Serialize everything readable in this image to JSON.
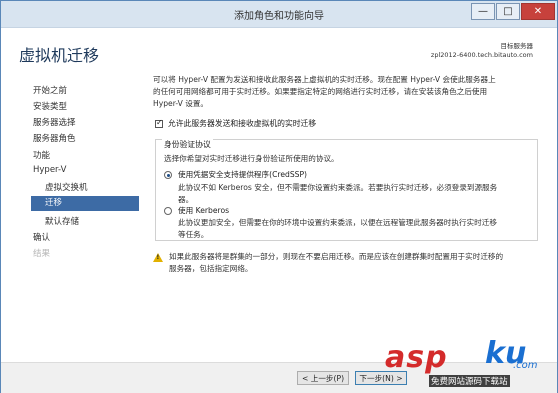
{
  "window": {
    "title": "添加角色和功能向导",
    "controls": {
      "minimize": "—",
      "maximize": "□",
      "close": "✕"
    }
  },
  "header": {
    "page_title": "虚拟机迁移",
    "destination_label": "目标服务器",
    "destination_server": "zpl2012-6400.tech.bitauto.com"
  },
  "nav": {
    "items": [
      {
        "label": "开始之前",
        "state": "normal"
      },
      {
        "label": "安装类型",
        "state": "normal"
      },
      {
        "label": "服务器选择",
        "state": "normal"
      },
      {
        "label": "服务器角色",
        "state": "normal"
      },
      {
        "label": "功能",
        "state": "normal"
      },
      {
        "label": "Hyper-V",
        "state": "normal"
      },
      {
        "label": "虚拟交换机",
        "state": "normal"
      },
      {
        "label": "迁移",
        "state": "active"
      },
      {
        "label": "默认存储",
        "state": "normal"
      },
      {
        "label": "确认",
        "state": "normal"
      },
      {
        "label": "结果",
        "state": "disabled"
      }
    ]
  },
  "content": {
    "intro_lines": [
      "可以将 Hyper-V 配置为发送和接收此服务器上虚拟机的实时迁移。现在配置 Hyper-V 会使此服务器上",
      "的任何可用网络都可用于实时迁移。如果要指定特定的网络进行实时迁移，请在安装该角色之后使用",
      "Hyper-V 设置。"
    ],
    "allow_checkbox": {
      "label": "允许此服务器发送和接收虚拟机的实时迁移",
      "checked": true
    },
    "auth_group": {
      "title": "身份验证协议",
      "description": "选择你希望对实时迁移进行身份验证所使用的协议。",
      "options": [
        {
          "label": "使用凭据安全支持提供程序(CredSSP)",
          "selected": true,
          "desc_lines": [
            "此协议不如 Kerberos 安全，但不需要你设置约束委派。若要执行实时迁移，必须登录到源服务",
            "器。"
          ]
        },
        {
          "label": "使用 Kerberos",
          "selected": false,
          "desc_lines": [
            "此协议更加安全，但需要在你的环境中设置约束委派，以便在远程管理此服务器时执行实时迁移",
            "等任务。"
          ]
        }
      ]
    },
    "warning_lines": [
      "如果此服务器将是群集的一部分，则现在不要启用迁移。而是应该在创建群集时配置用于实时迁移的",
      "服务器，包括指定网络。"
    ]
  },
  "footer": {
    "prev_label": "< 上一步(P)",
    "next_label": "下一步(N) >"
  },
  "watermark": {
    "brand_part1": "asp",
    "brand_part2": "ku",
    "suffix": ".com",
    "subtitle": "免费网站源码下载站"
  },
  "colors": {
    "accent": "#3d6ba5",
    "title": "#1e395b",
    "close": "#c7413c"
  }
}
